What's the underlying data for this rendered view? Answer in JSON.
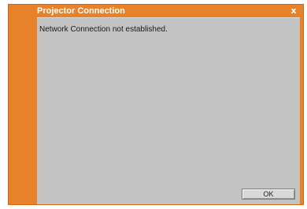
{
  "window": {
    "title": "Projector Connection",
    "close_glyph": "x",
    "accent_color": "#e8822a",
    "panel_color": "#c3c3c3"
  },
  "dialog": {
    "message": "Network Connection not established.",
    "ok_label": "OK"
  },
  "icons": {
    "close": "close-icon"
  }
}
